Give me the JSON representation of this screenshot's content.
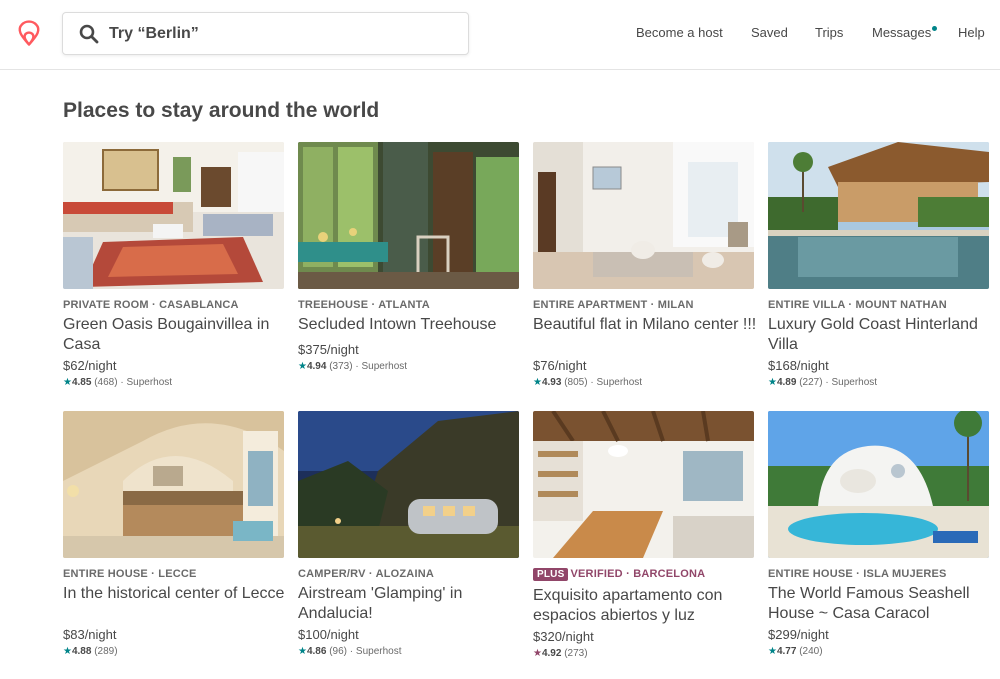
{
  "header": {
    "logo_name": "airbnb-logo",
    "search_placeholder": "Try “Berlin”",
    "nav": {
      "become_host": "Become a host",
      "saved": "Saved",
      "trips": "Trips",
      "messages": "Messages",
      "help": "Help"
    },
    "brand_color": "#FF5A5F",
    "notification_dot_color": "#008489"
  },
  "section": {
    "title": "Places to stay around the world"
  },
  "listings": [
    {
      "kicker": "PRIVATE ROOM · CASABLANCA",
      "title": "Green Oasis Bougainvillea in Casa",
      "price": "$62/night",
      "score": "4.85",
      "reviews": "(468)",
      "superhost": "· Superhost",
      "star_color": "#008489"
    },
    {
      "kicker": "TREEHOUSE · ATLANTA",
      "title": "Secluded Intown Treehouse",
      "price": "$375/night",
      "score": "4.94",
      "reviews": "(373)",
      "superhost": "· Superhost",
      "star_color": "#008489"
    },
    {
      "kicker": "ENTIRE APARTMENT · MILAN",
      "title": "Beautiful flat in Milano center !!!",
      "price": "$76/night",
      "score": "4.93",
      "reviews": "(805)",
      "superhost": "· Superhost",
      "star_color": "#008489"
    },
    {
      "kicker": "ENTIRE VILLA · MOUNT NATHAN",
      "title": "Luxury Gold Coast Hinterland Villa",
      "price": "$168/night",
      "score": "4.89",
      "reviews": "(227)",
      "superhost": "· Superhost",
      "star_color": "#008489"
    },
    {
      "kicker": "ENTIRE HOUSE · LECCE",
      "title": "In the historical center of Lecce",
      "price": "$83/night",
      "score": "4.88",
      "reviews": "(289)",
      "superhost": "",
      "star_color": "#008489"
    },
    {
      "kicker": "CAMPER/RV · ALOZAINA",
      "title": "Airstream 'Glamping' in Andalucia!",
      "price": "$100/night",
      "score": "4.86",
      "reviews": "(96)",
      "superhost": "· Superhost",
      "star_color": "#008489"
    },
    {
      "plus": "PLUS",
      "kicker": "VERIFIED · BARCELONA",
      "title": "Exquisito apartamento con espacios abiertos y luz",
      "price": "$320/night",
      "score": "4.92",
      "reviews": "(273)",
      "superhost": "",
      "star_color": "#914669"
    },
    {
      "kicker": "ENTIRE HOUSE · ISLA MUJERES",
      "title": "The World Famous Seashell House ~ Casa Caracol",
      "price": "$299/night",
      "score": "4.77",
      "reviews": "(240)",
      "superhost": "",
      "star_color": "#008489"
    }
  ],
  "star_glyph": "★"
}
